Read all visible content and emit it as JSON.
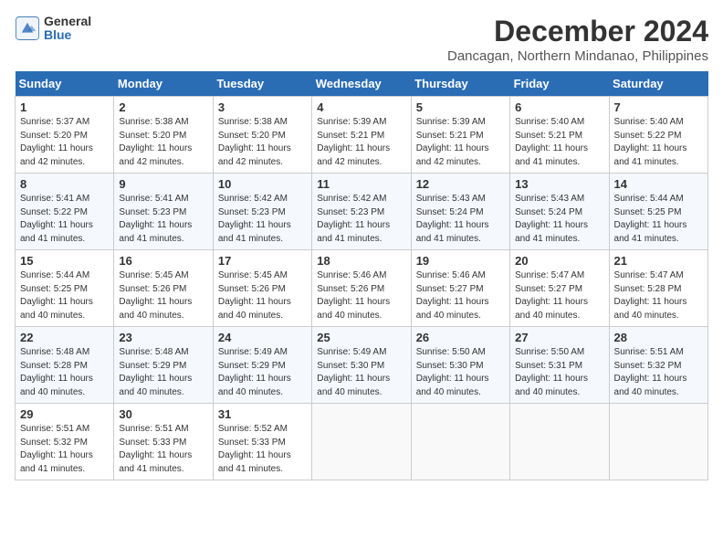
{
  "header": {
    "logo_general": "General",
    "logo_blue": "Blue",
    "title": "December 2024",
    "subtitle": "Dancagan, Northern Mindanao, Philippines"
  },
  "days_of_week": [
    "Sunday",
    "Monday",
    "Tuesday",
    "Wednesday",
    "Thursday",
    "Friday",
    "Saturday"
  ],
  "weeks": [
    [
      {
        "day": "1",
        "sunrise": "5:37 AM",
        "sunset": "5:20 PM",
        "daylight": "11 hours and 42 minutes."
      },
      {
        "day": "2",
        "sunrise": "5:38 AM",
        "sunset": "5:20 PM",
        "daylight": "11 hours and 42 minutes."
      },
      {
        "day": "3",
        "sunrise": "5:38 AM",
        "sunset": "5:20 PM",
        "daylight": "11 hours and 42 minutes."
      },
      {
        "day": "4",
        "sunrise": "5:39 AM",
        "sunset": "5:21 PM",
        "daylight": "11 hours and 42 minutes."
      },
      {
        "day": "5",
        "sunrise": "5:39 AM",
        "sunset": "5:21 PM",
        "daylight": "11 hours and 42 minutes."
      },
      {
        "day": "6",
        "sunrise": "5:40 AM",
        "sunset": "5:21 PM",
        "daylight": "11 hours and 41 minutes."
      },
      {
        "day": "7",
        "sunrise": "5:40 AM",
        "sunset": "5:22 PM",
        "daylight": "11 hours and 41 minutes."
      }
    ],
    [
      {
        "day": "8",
        "sunrise": "5:41 AM",
        "sunset": "5:22 PM",
        "daylight": "11 hours and 41 minutes."
      },
      {
        "day": "9",
        "sunrise": "5:41 AM",
        "sunset": "5:23 PM",
        "daylight": "11 hours and 41 minutes."
      },
      {
        "day": "10",
        "sunrise": "5:42 AM",
        "sunset": "5:23 PM",
        "daylight": "11 hours and 41 minutes."
      },
      {
        "day": "11",
        "sunrise": "5:42 AM",
        "sunset": "5:23 PM",
        "daylight": "11 hours and 41 minutes."
      },
      {
        "day": "12",
        "sunrise": "5:43 AM",
        "sunset": "5:24 PM",
        "daylight": "11 hours and 41 minutes."
      },
      {
        "day": "13",
        "sunrise": "5:43 AM",
        "sunset": "5:24 PM",
        "daylight": "11 hours and 41 minutes."
      },
      {
        "day": "14",
        "sunrise": "5:44 AM",
        "sunset": "5:25 PM",
        "daylight": "11 hours and 41 minutes."
      }
    ],
    [
      {
        "day": "15",
        "sunrise": "5:44 AM",
        "sunset": "5:25 PM",
        "daylight": "11 hours and 40 minutes."
      },
      {
        "day": "16",
        "sunrise": "5:45 AM",
        "sunset": "5:26 PM",
        "daylight": "11 hours and 40 minutes."
      },
      {
        "day": "17",
        "sunrise": "5:45 AM",
        "sunset": "5:26 PM",
        "daylight": "11 hours and 40 minutes."
      },
      {
        "day": "18",
        "sunrise": "5:46 AM",
        "sunset": "5:26 PM",
        "daylight": "11 hours and 40 minutes."
      },
      {
        "day": "19",
        "sunrise": "5:46 AM",
        "sunset": "5:27 PM",
        "daylight": "11 hours and 40 minutes."
      },
      {
        "day": "20",
        "sunrise": "5:47 AM",
        "sunset": "5:27 PM",
        "daylight": "11 hours and 40 minutes."
      },
      {
        "day": "21",
        "sunrise": "5:47 AM",
        "sunset": "5:28 PM",
        "daylight": "11 hours and 40 minutes."
      }
    ],
    [
      {
        "day": "22",
        "sunrise": "5:48 AM",
        "sunset": "5:28 PM",
        "daylight": "11 hours and 40 minutes."
      },
      {
        "day": "23",
        "sunrise": "5:48 AM",
        "sunset": "5:29 PM",
        "daylight": "11 hours and 40 minutes."
      },
      {
        "day": "24",
        "sunrise": "5:49 AM",
        "sunset": "5:29 PM",
        "daylight": "11 hours and 40 minutes."
      },
      {
        "day": "25",
        "sunrise": "5:49 AM",
        "sunset": "5:30 PM",
        "daylight": "11 hours and 40 minutes."
      },
      {
        "day": "26",
        "sunrise": "5:50 AM",
        "sunset": "5:30 PM",
        "daylight": "11 hours and 40 minutes."
      },
      {
        "day": "27",
        "sunrise": "5:50 AM",
        "sunset": "5:31 PM",
        "daylight": "11 hours and 40 minutes."
      },
      {
        "day": "28",
        "sunrise": "5:51 AM",
        "sunset": "5:32 PM",
        "daylight": "11 hours and 40 minutes."
      }
    ],
    [
      {
        "day": "29",
        "sunrise": "5:51 AM",
        "sunset": "5:32 PM",
        "daylight": "11 hours and 41 minutes."
      },
      {
        "day": "30",
        "sunrise": "5:51 AM",
        "sunset": "5:33 PM",
        "daylight": "11 hours and 41 minutes."
      },
      {
        "day": "31",
        "sunrise": "5:52 AM",
        "sunset": "5:33 PM",
        "daylight": "11 hours and 41 minutes."
      },
      null,
      null,
      null,
      null
    ]
  ],
  "labels": {
    "sunrise": "Sunrise:",
    "sunset": "Sunset:",
    "daylight": "Daylight:"
  }
}
